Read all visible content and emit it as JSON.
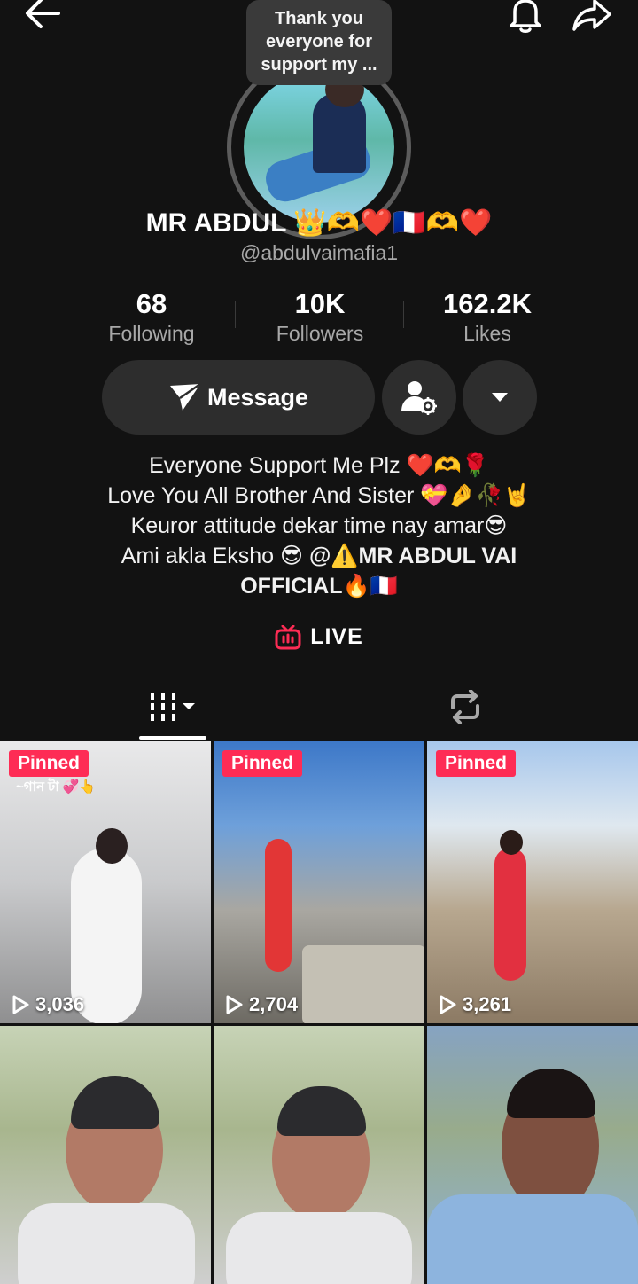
{
  "bubble": {
    "text": "Thank you everyone for support  my ..."
  },
  "profile": {
    "display_name": "MR ABDUL 👑🫶❤️🇫🇷🫶❤️",
    "handle": "@abdulvaimafia1"
  },
  "stats": {
    "following": {
      "value": "68",
      "label": "Following"
    },
    "followers": {
      "value": "10K",
      "label": "Followers"
    },
    "likes": {
      "value": "162.2K",
      "label": "Likes"
    }
  },
  "actions": {
    "message_label": "Message"
  },
  "bio": {
    "line1": "Everyone Support Me Plz ❤️🫶🌹",
    "line2": "Love You All Brother And Sister 💝🤌🥀🤘",
    "line3": "Keuror attitude dekar time nay amar😎",
    "line4_text": "Ami akla Eksho 😎 ",
    "line4_mention": "@⚠️MR ABDUL VAI",
    "line5_mention": "OFFICIAL🔥🇫🇷"
  },
  "live": {
    "label": "LIVE",
    "color": "#fe2c55"
  },
  "tabs": {
    "videos": "videos-grid-icon",
    "reposts": "repost-icon"
  },
  "videos": [
    {
      "pinned": "Pinned",
      "caption": "~গান টা 💞👆",
      "views": "3,036"
    },
    {
      "pinned": "Pinned",
      "views": "2,704"
    },
    {
      "pinned": "Pinned",
      "views": "3,261"
    },
    {
      "views": ""
    },
    {
      "views": ""
    },
    {
      "views": ""
    }
  ],
  "colors": {
    "background": "#121212",
    "button": "#2d2d2d",
    "accent": "#fe2c55",
    "muted_text": "#a8a8a8"
  }
}
